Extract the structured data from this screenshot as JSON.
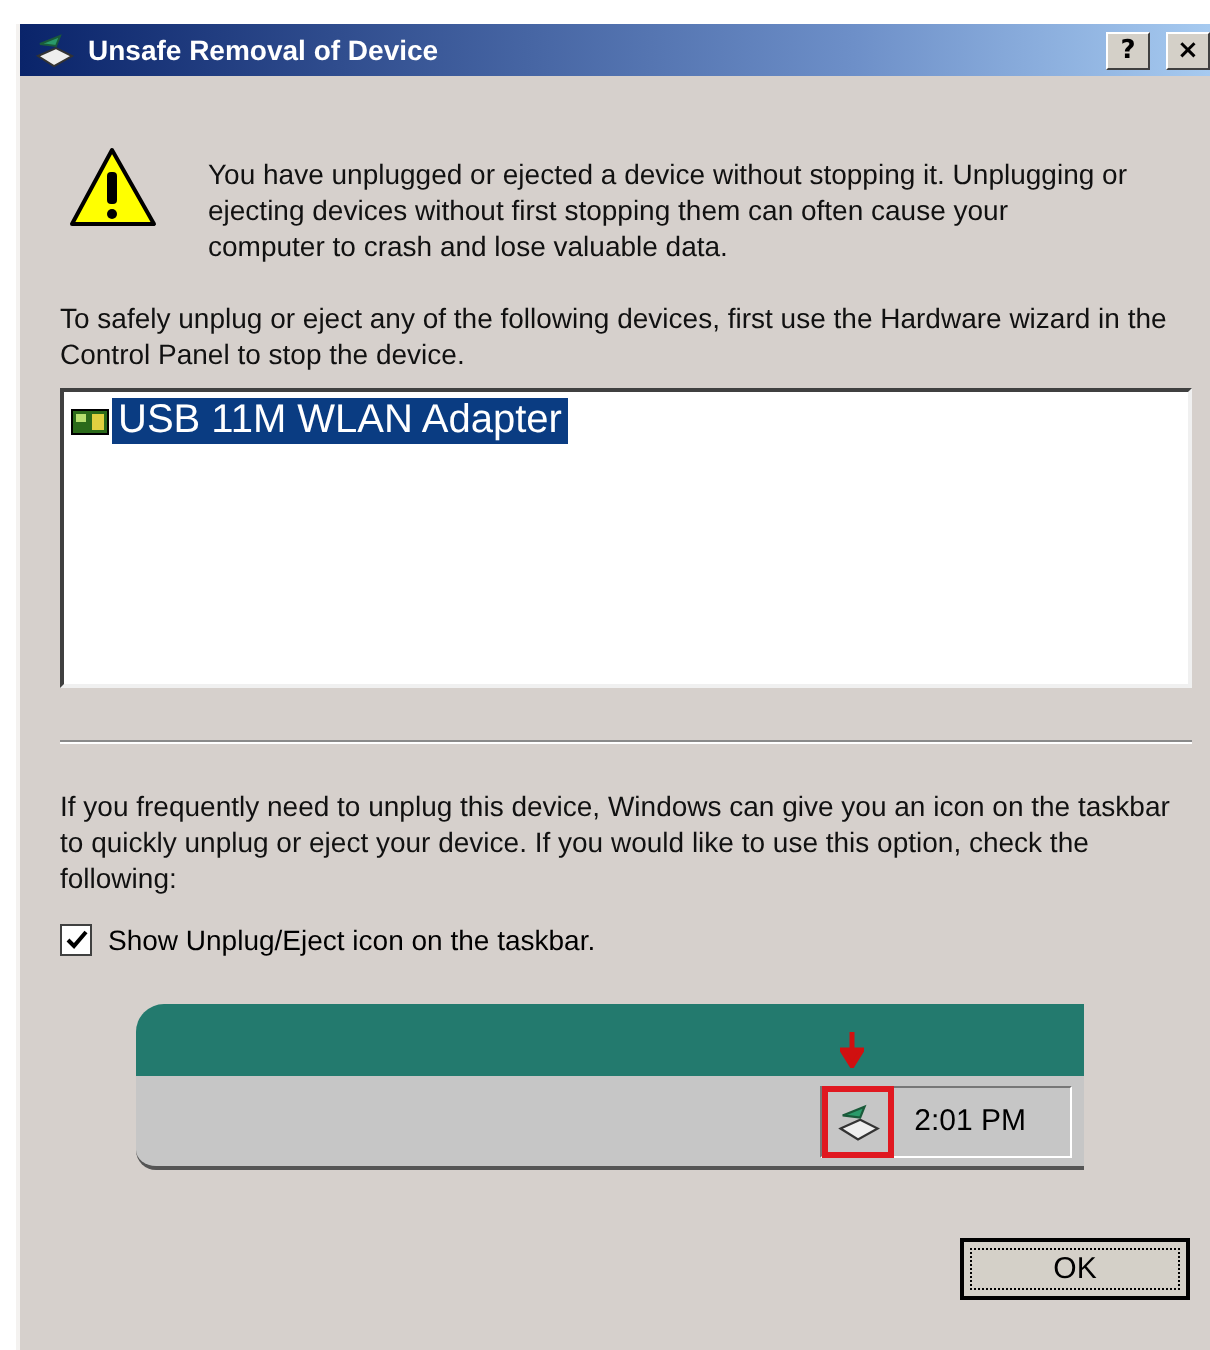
{
  "window": {
    "title": "Unsafe Removal of Device",
    "title_buttons": [
      "?",
      "×"
    ]
  },
  "warning": {
    "message": "You have unplugged or ejected a device without stopping it. Unplugging or ejecting devices without first stopping them can often cause your computer to crash and lose valuable data."
  },
  "instructions": "To safely unplug or eject any of the following devices, first use the Hardware wizard in the Control Panel to stop the device.",
  "devices": [
    {
      "name": "USB 11M WLAN Adapter",
      "selected": true
    }
  ],
  "option_info": "If you frequently need to unplug this device, Windows can give you an icon on the taskbar to quickly unplug or eject your device. If you would like to use this option, check the following:",
  "option": {
    "label": "Show Unplug/Eject icon on the taskbar.",
    "checked": true
  },
  "taskbar_preview": {
    "clock": "2:01 PM",
    "highlighted": true
  },
  "buttons": [
    "OK"
  ]
}
